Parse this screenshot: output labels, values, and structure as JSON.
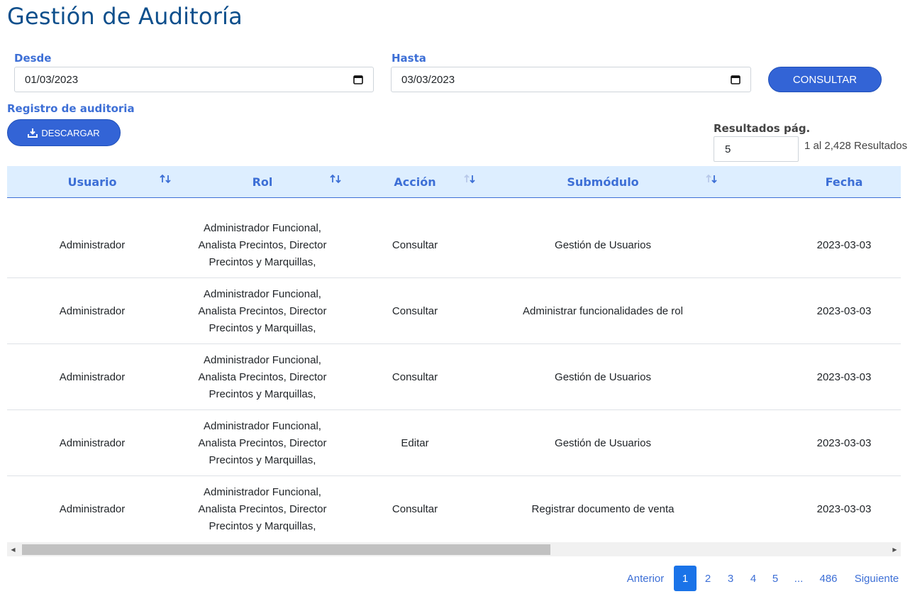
{
  "header": {
    "title": "Gestión de Auditoría"
  },
  "filters": {
    "from_label": "Desde",
    "from_value": "01/03/2023",
    "to_label": "Hasta",
    "to_value": "03/03/2023",
    "consult_label": "CONSULTAR"
  },
  "audit": {
    "section_label": "Registro de auditoria",
    "download_label": "DESCARGAR",
    "per_page_label": "Resultados pág.",
    "per_page_value": "5",
    "results_text": "1 al 2,428 Resultados"
  },
  "table": {
    "columns": [
      "Usuario",
      "Rol",
      "Acción",
      "Submódulo",
      "Fecha"
    ],
    "rows": [
      {
        "user": "Administrador",
        "role": [
          "Administrador Funcional,",
          "Analista Precintos, Director",
          "Precintos y Marquillas,"
        ],
        "action": "Consultar",
        "submodule": "Gestión de Usuarios",
        "date": "2023-03-03"
      },
      {
        "user": "Administrador",
        "role": [
          "Administrador Funcional,",
          "Analista Precintos, Director",
          "Precintos y Marquillas,"
        ],
        "action": "Consultar",
        "submodule": "Administrar funcionalidades de rol",
        "date": "2023-03-03"
      },
      {
        "user": "Administrador",
        "role": [
          "Administrador Funcional,",
          "Analista Precintos, Director",
          "Precintos y Marquillas,"
        ],
        "action": "Consultar",
        "submodule": "Gestión de Usuarios",
        "date": "2023-03-03"
      },
      {
        "user": "Administrador",
        "role": [
          "Administrador Funcional,",
          "Analista Precintos, Director",
          "Precintos y Marquillas,"
        ],
        "action": "Editar",
        "submodule": "Gestión de Usuarios",
        "date": "2023-03-03"
      },
      {
        "user": "Administrador",
        "role": [
          "Administrador Funcional,",
          "Analista Precintos, Director",
          "Precintos y Marquillas,"
        ],
        "action": "Consultar",
        "submodule": "Registrar documento de venta",
        "date": "2023-03-03"
      }
    ]
  },
  "pagination": {
    "prev_label": "Anterior",
    "pages": [
      "1",
      "2",
      "3",
      "4",
      "5",
      "...",
      "486"
    ],
    "active_page": "1",
    "next_label": "Siguiente"
  },
  "icons": {
    "calendar": "calendar-icon",
    "download": "download-icon",
    "sort": "sort-arrows-icon"
  },
  "colors": {
    "title": "#0d4f8c",
    "accent": "#3d6fd6",
    "button": "#3364d6",
    "header_bg": "#ddeeff",
    "active_page": "#1a73e8"
  }
}
